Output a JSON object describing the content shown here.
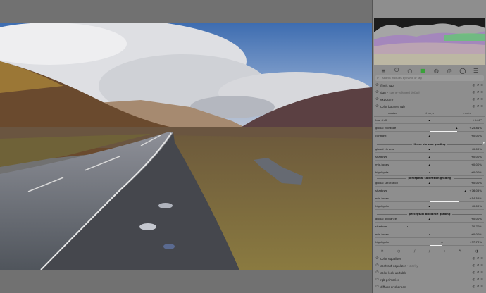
{
  "photo": {
    "sky_top": "#3f6fb2",
    "sky_mid": "#6b90c4",
    "cloud": "#e8e8ea",
    "hill_left": "#7a5a34",
    "hill_right": "#5a3e3e",
    "road": "#5f646c",
    "grass": "#7d6a3b"
  },
  "panel": {
    "tab_icons": [
      "sliders-icon",
      "power-icon",
      "circle-icon",
      "star-icon",
      "drop-icon",
      "aperture-icon",
      "ring-icon",
      "menu-icon"
    ],
    "search_placeholder": "search modules by name or tag",
    "modules": [
      {
        "name": "filmic rgb",
        "sub": ""
      },
      {
        "name": "dgn",
        "sub": " • scene-referred default"
      },
      {
        "name": "exposure",
        "sub": ""
      },
      {
        "name": "color balance rgb",
        "sub": ""
      }
    ],
    "cb_tabs": [
      "master",
      "4 ways",
      "masks"
    ],
    "sections": {
      "linear": "linear chroma grading",
      "sat": "perceptual saturation grading",
      "bri": "perceptual brilliance grading"
    },
    "sliders_top": [
      {
        "label": "hue shift",
        "value": "+0.00°",
        "frac": 0.5,
        "center": 0.5
      },
      {
        "label": "global vibrance",
        "value": "+25.81%",
        "frac": 0.75,
        "center": 0.5
      },
      {
        "label": "contrast",
        "value": "+0.00%",
        "frac": 0.5,
        "center": 0.5
      }
    ],
    "sliders_linear": [
      {
        "label": "global chroma",
        "value": "+0.00%",
        "frac": 0.5,
        "center": 0.5
      },
      {
        "label": "shadows",
        "value": "+0.00%",
        "frac": 0.5,
        "center": 0.5
      },
      {
        "label": "mid-tones",
        "value": "+0.00%",
        "frac": 0.5,
        "center": 0.5
      },
      {
        "label": "highlights",
        "value": "+0.00%",
        "frac": 0.5,
        "center": 0.5
      }
    ],
    "sliders_sat": [
      {
        "label": "global saturation",
        "value": "+0.00%",
        "frac": 0.5,
        "center": 0.5
      },
      {
        "label": "shadows",
        "value": "+76.05%",
        "frac": 0.83,
        "center": 0.5
      },
      {
        "label": "mid-tones",
        "value": "+54.52%",
        "frac": 0.77,
        "center": 0.5
      },
      {
        "label": "highlights",
        "value": "+0.00%",
        "frac": 0.5,
        "center": 0.5
      }
    ],
    "sliders_bri": [
      {
        "label": "global brilliance",
        "value": "+0.00%",
        "frac": 0.5,
        "center": 0.5
      },
      {
        "label": "shadows",
        "value": "-30.70%",
        "frac": 0.3,
        "center": 0.5
      },
      {
        "label": "mid-tones",
        "value": "+0.00%",
        "frac": 0.5,
        "center": 0.5
      },
      {
        "label": "highlights",
        "value": "+37.73%",
        "frac": 0.62,
        "center": 0.5
      }
    ],
    "bottom_icons": [
      "x-icon",
      "circle-icon",
      "brush-icon",
      "brush-icon",
      "eyedropper-icon",
      "pen-icon",
      "half-circle-icon"
    ],
    "modules_below": [
      {
        "name": "color equalizer",
        "sub": ""
      },
      {
        "name": "contrast equalizer",
        "sub": " • clarity"
      },
      {
        "name": "color look up table",
        "sub": ""
      },
      {
        "name": "rgb primaries",
        "sub": ""
      },
      {
        "name": "diffuse or sharpen",
        "sub": ""
      }
    ]
  }
}
